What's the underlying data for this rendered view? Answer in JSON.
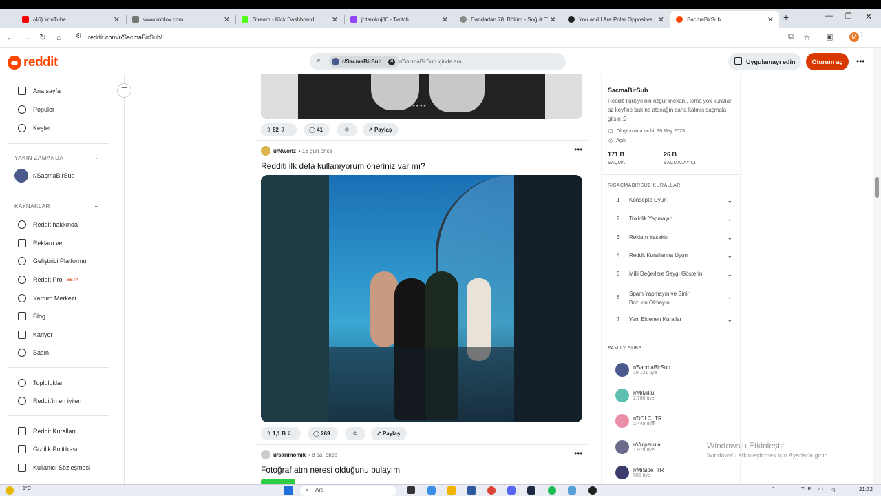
{
  "browser": {
    "tabs": [
      {
        "label": "(46) YouTube",
        "color": "#ff0000"
      },
      {
        "label": "www.roblox.com",
        "color": "#777777"
      },
      {
        "label": "Stream - Kick Dashboard",
        "color": "#53fc18"
      },
      {
        "label": "jotarokuj00 - Twitch",
        "color": "#9146ff"
      },
      {
        "label": "Dandadan 78. Bölüm - Soğuk T",
        "color": "#888888"
      },
      {
        "label": "You and I Are Polar Opposites",
        "color": "#222222"
      },
      {
        "label": "SacmaBirSub",
        "color": "#ff4500"
      }
    ],
    "url": "reddit.com/r/SacmaBirSub/",
    "profile_initial": "M"
  },
  "header": {
    "logo": "reddit",
    "search_chip": "r/SacmaBirSub",
    "search_placeholder": "r/SacmaBirSub içinde ara",
    "get_app": "Uygulamayı edin",
    "login": "Oturum aç"
  },
  "sidebar": {
    "top": [
      {
        "label": "Ana sayfa",
        "icon": "home-icon"
      },
      {
        "label": "Popüler",
        "icon": "popular-icon"
      },
      {
        "label": "Keşfet",
        "icon": "explore-icon"
      }
    ],
    "recent_header": "YAKIN ZAMANDA",
    "recent": [
      {
        "label": "r/SacmaBirSub"
      }
    ],
    "resources_header": "KAYNAKLAR",
    "resources": [
      {
        "label": "Reddit hakkında"
      },
      {
        "label": "Reklam ver"
      },
      {
        "label": "Geliştirici Platformu"
      },
      {
        "label": "Reddit Pro",
        "badge": "BETA"
      },
      {
        "label": "Yardım Merkezi"
      },
      {
        "label": "Blog"
      },
      {
        "label": "Kariyer"
      },
      {
        "label": "Basın"
      }
    ],
    "communities": [
      {
        "label": "Topluluklar"
      },
      {
        "label": "Reddit'in en iyileri"
      }
    ],
    "legal": [
      {
        "label": "Reddit Kuralları"
      },
      {
        "label": "Gizlilik Politikası"
      },
      {
        "label": "Kullanıcı Sözleşmesi"
      }
    ]
  },
  "feed": {
    "post1_actions": {
      "votes": "82",
      "comments": "41",
      "share": "Paylaş"
    },
    "post2": {
      "author": "u/Nwonz",
      "time": "16 gün önce",
      "title": "Redditi ilk defa kullanıyorum öneriniz var mı?",
      "votes": "1,1 B",
      "comments": "269",
      "share": "Paylaş"
    },
    "post3": {
      "author": "u/sarimomik",
      "time": "8 sa. önce",
      "title": "Fotoğraf atın neresi olduğunu bulayım"
    }
  },
  "about": {
    "name": "SacmaBirSub",
    "description": "Reddit Türkiye'nin özgür mekanı, tema yok kurallar az keyfine bak ne atacağın sana kalmış saçmala gitsin :3",
    "created": "Oluşturulma tarihi: 30 May 2025",
    "visibility": "Açık",
    "members_value": "171 B",
    "members_label": "SAÇMA",
    "online_value": "26 B",
    "online_label": "SAÇMALAYICI"
  },
  "rules": {
    "header": "R/SACMABIRSUB KURALLARI",
    "items": [
      {
        "num": "1",
        "label": "Konsepte Uyun"
      },
      {
        "num": "2",
        "label": "Toxiclik Yapmayın"
      },
      {
        "num": "3",
        "label": "Reklam Yasaktır"
      },
      {
        "num": "4",
        "label": "Reddit Kurallarına Uyun"
      },
      {
        "num": "5",
        "label": "Milli Değerlere Saygı Gösterin"
      },
      {
        "num": "6",
        "label": "Spam Yapmayın ve Sinir Bozucu Olmayın"
      },
      {
        "num": "7",
        "label": "Yeni Eklenen Kurallar"
      }
    ]
  },
  "family": {
    "header": "FAMILY SUBS",
    "items": [
      {
        "name": "r/SacmaBirSub",
        "members": "19.131 üye",
        "color": "#4a5a8c"
      },
      {
        "name": "r/MiMiku",
        "members": "2.780 üye",
        "color": "#5cbfb0"
      },
      {
        "name": "r/DDLC_TR",
        "members": "2.448 üye",
        "color": "#e98fa8"
      },
      {
        "name": "r/Vulpecula",
        "members": "1.978 üye",
        "color": "#6a6a8a"
      },
      {
        "name": "r/MiSide_TR",
        "members": "586 üye",
        "color": "#3c3c6c"
      }
    ]
  },
  "watermark": {
    "title": "Windows'u Etkinleştir",
    "subtitle": "Windows'u etkinleştirmek için Ayarlar'a gidin."
  },
  "taskbar": {
    "weather": "1°C",
    "search": "Ara",
    "lang": "TUR",
    "time": "21:32"
  }
}
